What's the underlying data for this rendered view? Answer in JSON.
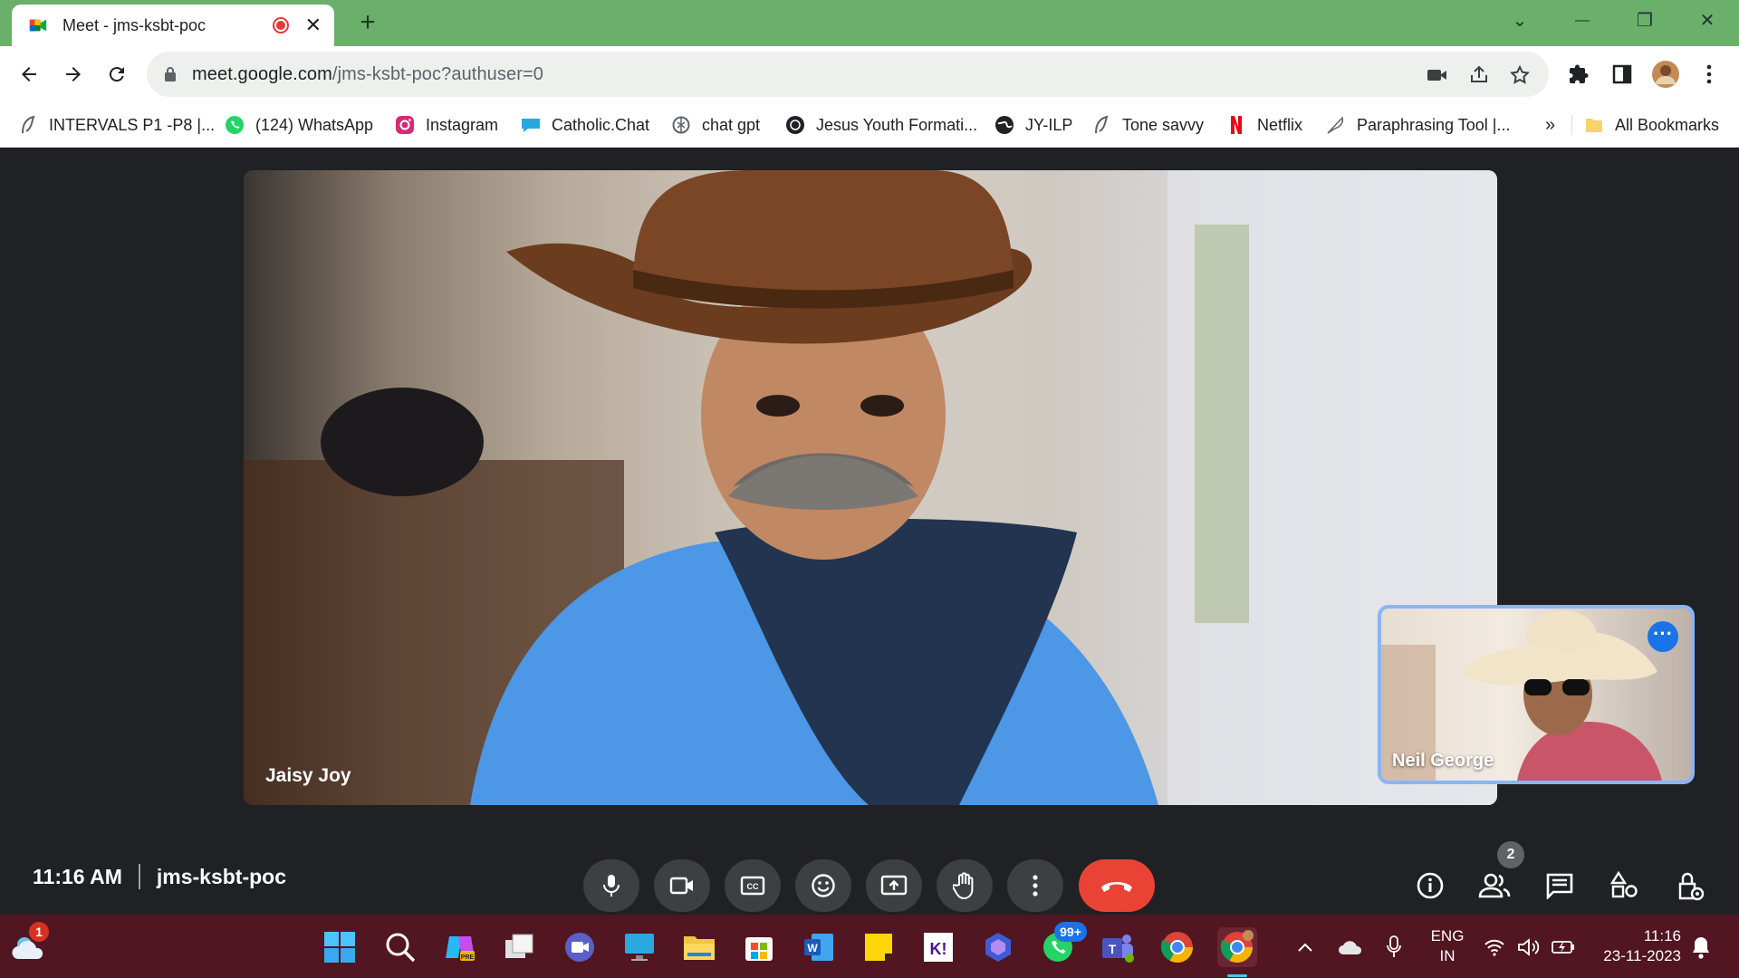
{
  "browser": {
    "tab": {
      "title": "Meet - jms-ksbt-poc",
      "close": "✕"
    },
    "new_tab": "+",
    "window_controls": {
      "tab_search": "⌄",
      "minimize": "—",
      "restore": "❐",
      "close": "✕"
    },
    "url": {
      "host": "meet.google.com",
      "path": "/jms-ksbt-poc?authuser=0"
    },
    "bookmarks": [
      {
        "label": "INTERVALS P1 -P8 |...",
        "icon": "leaf-icon"
      },
      {
        "label": "(124) WhatsApp",
        "icon": "whatsapp-icon"
      },
      {
        "label": "Instagram",
        "icon": "instagram-icon"
      },
      {
        "label": "Catholic.Chat",
        "icon": "catholic-chat-icon"
      },
      {
        "label": "chat gpt",
        "icon": "openai-icon"
      },
      {
        "label": "Jesus Youth Formati...",
        "icon": "jesus-youth-icon"
      },
      {
        "label": "JY-ILP",
        "icon": "globe-icon"
      },
      {
        "label": "Tone savvy",
        "icon": "leaf-icon"
      },
      {
        "label": "Netflix",
        "icon": "netflix-icon"
      },
      {
        "label": "Paraphrasing Tool |...",
        "icon": "quill-icon"
      }
    ],
    "bookmarks_overflow": "»",
    "all_bookmarks": "All Bookmarks"
  },
  "meet": {
    "main_participant": "Jaisy Joy",
    "self_participant": "Neil George",
    "time": "11:16 AM",
    "meeting_code": "jms-ksbt-poc",
    "participant_count": "2",
    "controls": [
      "mic-icon",
      "camera-icon",
      "captions-icon",
      "emoji-icon",
      "present-icon",
      "raise-hand-icon",
      "more-options-icon"
    ],
    "right_controls": [
      "info-icon",
      "people-icon",
      "chat-icon",
      "activities-icon",
      "host-controls-icon"
    ]
  },
  "taskbar": {
    "weather_badge": "1",
    "whatsapp_badge": "99+",
    "language": {
      "line1": "ENG",
      "line2": "IN"
    },
    "clock": {
      "time": "11:16",
      "date": "23-11-2023"
    }
  },
  "colors": {
    "titlebar": "#6ab06a",
    "meet_bg": "#202124",
    "end_call": "#ea4335",
    "accent": "#1a73e8",
    "taskbar": "#521522"
  }
}
